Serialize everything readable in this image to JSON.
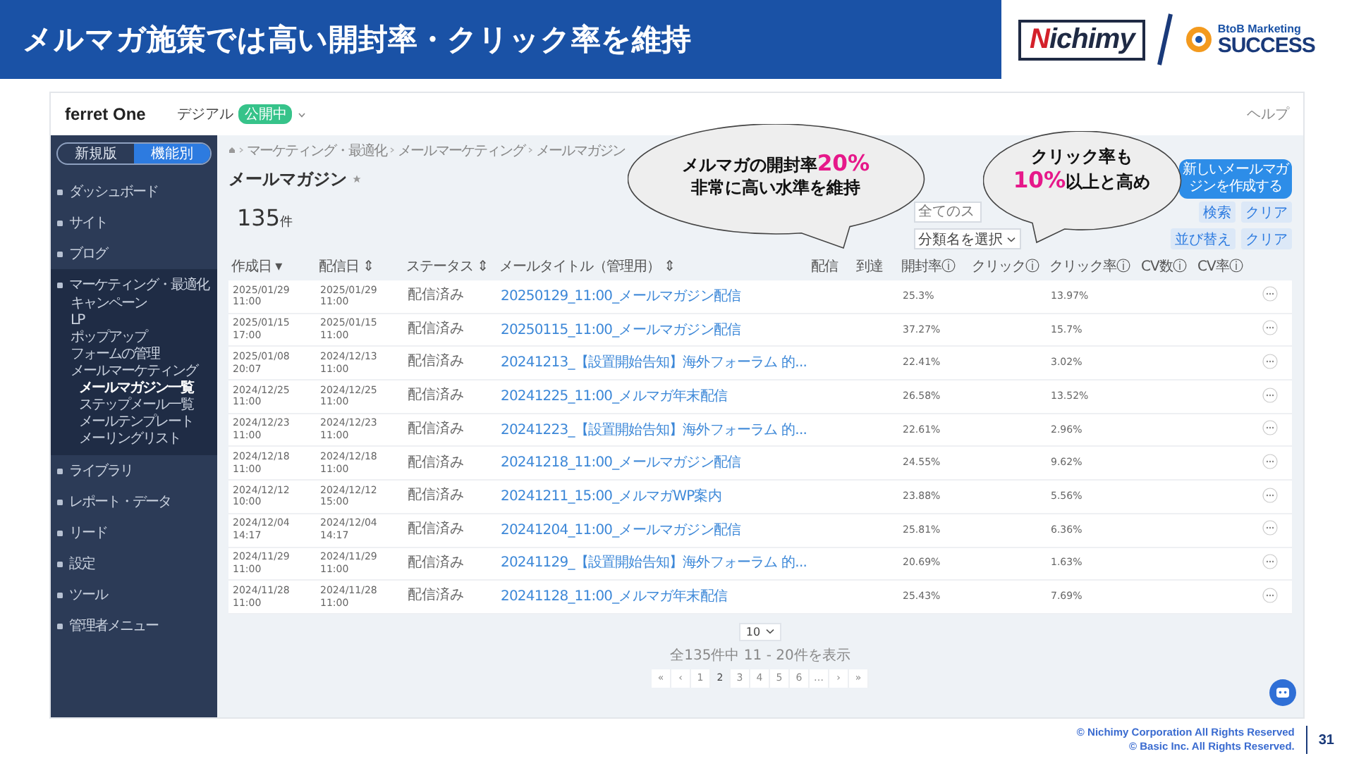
{
  "slide": {
    "title": "メルマガ施策では高い開封率・クリック率を維持",
    "partner_logo": "Nichimy",
    "success_logo": {
      "tagline": "BtoB Marketing",
      "word": "SUCCESS"
    },
    "copyright": [
      "© Nichimy Corporation All Rights Reserved",
      "© Basic Inc. All Rights Reserved."
    ],
    "page_number": "31"
  },
  "app": {
    "brand": "ferret One",
    "workspace": "デジアル",
    "workspace_badge": "公開中",
    "help": "ヘルプ",
    "mode_toggle": [
      {
        "label": "新規版",
        "selected": false
      },
      {
        "label": "機能別",
        "selected": true
      }
    ],
    "nav": [
      {
        "label": "ダッシュボード",
        "expanded": false
      },
      {
        "label": "サイト",
        "expanded": false
      },
      {
        "label": "ブログ",
        "expanded": false
      },
      {
        "label": "マーケティング・最適化",
        "expanded": true,
        "children": [
          {
            "label": "キャンペーン"
          },
          {
            "label": "LP"
          },
          {
            "label": "ポップアップ"
          },
          {
            "label": "フォームの管理"
          },
          {
            "label": "メールマーケティング",
            "children": [
              {
                "label": "メールマガジン一覧",
                "selected": true
              },
              {
                "label": "ステップメール一覧",
                "selected": false
              },
              {
                "label": "メールテンプレート",
                "selected": false
              },
              {
                "label": "メーリングリスト",
                "selected": false
              }
            ]
          }
        ]
      },
      {
        "label": "ライブラリ",
        "expanded": false
      },
      {
        "label": "レポート・データ",
        "expanded": false
      },
      {
        "label": "リード",
        "expanded": false
      },
      {
        "label": "設定",
        "expanded": false
      },
      {
        "label": "ツール",
        "expanded": false
      },
      {
        "label": "管理者メニュー",
        "expanded": false
      }
    ],
    "breadcrumb": [
      "マーケティング・最適化",
      "メールマーケティング",
      "メールマガジン"
    ],
    "page_title": "メールマガジン",
    "count": "135",
    "count_unit": "件",
    "create_button": "新しいメールマガジンを作成する",
    "status_filter": {
      "placeholder": "全てのス"
    },
    "search_button": "検索",
    "clear_button": "クリア",
    "category_select": "分類名を選択",
    "sort_button": "並び替え",
    "clear_button_2": "クリア",
    "table": {
      "columns": [
        "作成日 ▾",
        "配信日 ⇕",
        "ステータス ⇕",
        "メールタイトル（管理用） ⇕",
        "配信",
        "到達",
        "開封率ⓘ",
        "クリックⓘ",
        "クリック率ⓘ",
        "CV数ⓘ",
        "CV率ⓘ"
      ],
      "rows": [
        {
          "created": "2025/01/29\n11:00",
          "sent": "2025/01/29\n11:00",
          "status": "配信済み",
          "title": "20250129_11:00_メールマガジン配信",
          "open_rate": "25.3%",
          "click_rate": "13.97%"
        },
        {
          "created": "2025/01/15\n17:00",
          "sent": "2025/01/15\n11:00",
          "status": "配信済み",
          "title": "20250115_11:00_メールマガジン配信",
          "open_rate": "37.27%",
          "click_rate": "15.7%"
        },
        {
          "created": "2025/01/08\n20:07",
          "sent": "2024/12/13\n11:00",
          "status": "配信済み",
          "title": "20241213_【設置開始告知】海外フォーラム 的...",
          "open_rate": "22.41%",
          "click_rate": "3.02%"
        },
        {
          "created": "2024/12/25\n11:00",
          "sent": "2024/12/25\n11:00",
          "status": "配信済み",
          "title": "20241225_11:00_メルマガ年末配信",
          "open_rate": "26.58%",
          "click_rate": "13.52%"
        },
        {
          "created": "2024/12/23\n11:00",
          "sent": "2024/12/23\n11:00",
          "status": "配信済み",
          "title": "20241223_【設置開始告知】海外フォーラム 的...",
          "open_rate": "22.61%",
          "click_rate": "2.96%"
        },
        {
          "created": "2024/12/18\n11:00",
          "sent": "2024/12/18\n11:00",
          "status": "配信済み",
          "title": "20241218_11:00_メールマガジン配信",
          "open_rate": "24.55%",
          "click_rate": "9.62%"
        },
        {
          "created": "2024/12/12\n10:00",
          "sent": "2024/12/12\n15:00",
          "status": "配信済み",
          "title": "20241211_15:00_メルマガWP案内",
          "open_rate": "23.88%",
          "click_rate": "5.56%"
        },
        {
          "created": "2024/12/04\n14:17",
          "sent": "2024/12/04\n14:17",
          "status": "配信済み",
          "title": "20241204_11:00_メールマガジン配信",
          "open_rate": "25.81%",
          "click_rate": "6.36%"
        },
        {
          "created": "2024/11/29\n11:00",
          "sent": "2024/11/29\n11:00",
          "status": "配信済み",
          "title": "20241129_【設置開始告知】海外フォーラム 的...",
          "open_rate": "20.69%",
          "click_rate": "1.63%"
        },
        {
          "created": "2024/11/28\n11:00",
          "sent": "2024/11/28\n11:00",
          "status": "配信済み",
          "title": "20241128_11:00_メルマガ年末配信",
          "open_rate": "25.43%",
          "click_rate": "7.69%"
        }
      ]
    },
    "pagination": {
      "page_size": "10",
      "summary": "全135件中 11 - 20件を表示",
      "pages": [
        {
          "label": "«",
          "selected": false
        },
        {
          "label": "‹",
          "selected": false
        },
        {
          "label": "1",
          "selected": false
        },
        {
          "label": "2",
          "selected": true
        },
        {
          "label": "3",
          "selected": false
        },
        {
          "label": "4",
          "selected": false
        },
        {
          "label": "5",
          "selected": false
        },
        {
          "label": "6",
          "selected": false
        },
        {
          "label": "…",
          "selected": false
        },
        {
          "label": "›",
          "selected": false
        },
        {
          "label": "»",
          "selected": false
        }
      ]
    }
  },
  "callouts": [
    {
      "lines": [
        [
          {
            "text": "メルマガの開封率",
            "highlight": false
          },
          {
            "text": "20%",
            "highlight": true
          }
        ],
        [
          {
            "text": "非常に高い水準を維持",
            "highlight": false
          }
        ]
      ]
    },
    {
      "lines": [
        [
          {
            "text": "クリック率も",
            "highlight": false
          }
        ],
        [
          {
            "text": "10%",
            "highlight": true
          },
          {
            "text": "以上と高め",
            "highlight": false
          }
        ]
      ]
    }
  ]
}
